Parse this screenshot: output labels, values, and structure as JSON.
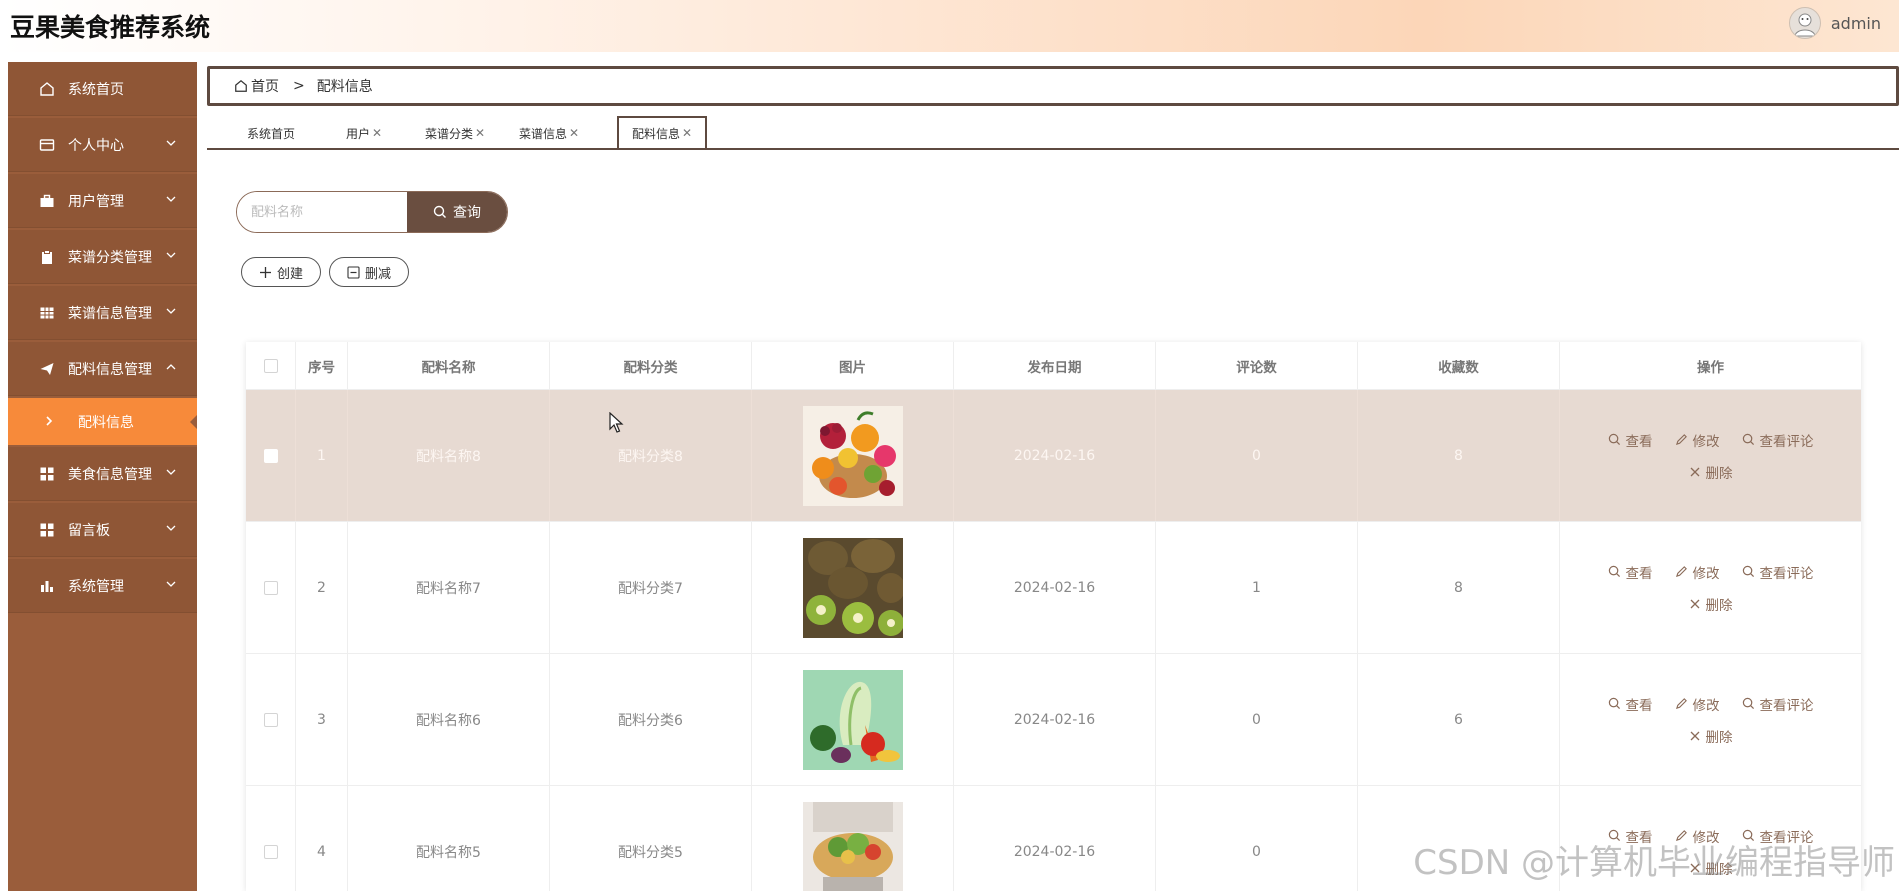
{
  "header": {
    "app_title": "豆果美食推荐系统",
    "username": "admin"
  },
  "sidebar": {
    "items": [
      {
        "label": "系统首页",
        "icon": "home-icon",
        "has_chevron": false
      },
      {
        "label": "个人中心",
        "icon": "card-icon",
        "has_chevron": true
      },
      {
        "label": "用户管理",
        "icon": "briefcase-icon",
        "has_chevron": true
      },
      {
        "label": "菜谱分类管理",
        "icon": "clipboard-icon",
        "has_chevron": true
      },
      {
        "label": "菜谱信息管理",
        "icon": "grid-icon",
        "has_chevron": true
      },
      {
        "label": "配料信息管理",
        "icon": "send-icon",
        "has_chevron": true,
        "expanded": true
      },
      {
        "label": "美食信息管理",
        "icon": "apps-icon",
        "has_chevron": true
      },
      {
        "label": "留言板",
        "icon": "apps-icon",
        "has_chevron": true
      },
      {
        "label": "系统管理",
        "icon": "bar-chart-icon",
        "has_chevron": true
      }
    ],
    "sub_item": {
      "label": "配料信息"
    }
  },
  "breadcrumb": {
    "home": "首页",
    "separator": ">",
    "current": "配料信息"
  },
  "tabs": [
    {
      "label": "系统首页",
      "closable": false
    },
    {
      "label": "用户",
      "closable": true
    },
    {
      "label": "菜谱分类",
      "closable": true
    },
    {
      "label": "菜谱信息",
      "closable": true
    },
    {
      "label": "配料信息",
      "closable": true,
      "active": true
    }
  ],
  "search": {
    "placeholder": "配料名称",
    "button_label": "查询"
  },
  "actions": {
    "create_label": "创建",
    "delete_label": "删减"
  },
  "table": {
    "columns": [
      "序号",
      "配料名称",
      "配料分类",
      "图片",
      "发布日期",
      "评论数",
      "收藏数",
      "操作"
    ],
    "rows": [
      {
        "index": "1",
        "name": "配料名称8",
        "category": "配料分类8",
        "image": "fruit-basket",
        "date": "2024-02-16",
        "comments": "0",
        "favorites": "8",
        "highlighted": true
      },
      {
        "index": "2",
        "name": "配料名称7",
        "category": "配料分类7",
        "image": "kiwi",
        "date": "2024-02-16",
        "comments": "1",
        "favorites": "8"
      },
      {
        "index": "3",
        "name": "配料名称6",
        "category": "配料分类6",
        "image": "vegetables",
        "date": "2024-02-16",
        "comments": "0",
        "favorites": "6"
      },
      {
        "index": "4",
        "name": "配料名称5",
        "category": "配料分类5",
        "image": "salad-bowl",
        "date": "2024-02-16",
        "comments": "0",
        "favorites": ""
      }
    ],
    "row_actions": {
      "view": "查看",
      "edit": "修改",
      "view_comments": "查看评论",
      "delete": "删除"
    }
  },
  "watermark": "CSDN @计算机毕业编程指导师",
  "colors": {
    "sidebar": "#9a5d3b",
    "sidebar_item": "#8f5636",
    "sidebar_active": "#f78a3a",
    "accent_dark": "#5e4a40",
    "search_button": "#6a4e40",
    "row_highlight": "#e7dad2",
    "action_text": "#8a6b59"
  }
}
